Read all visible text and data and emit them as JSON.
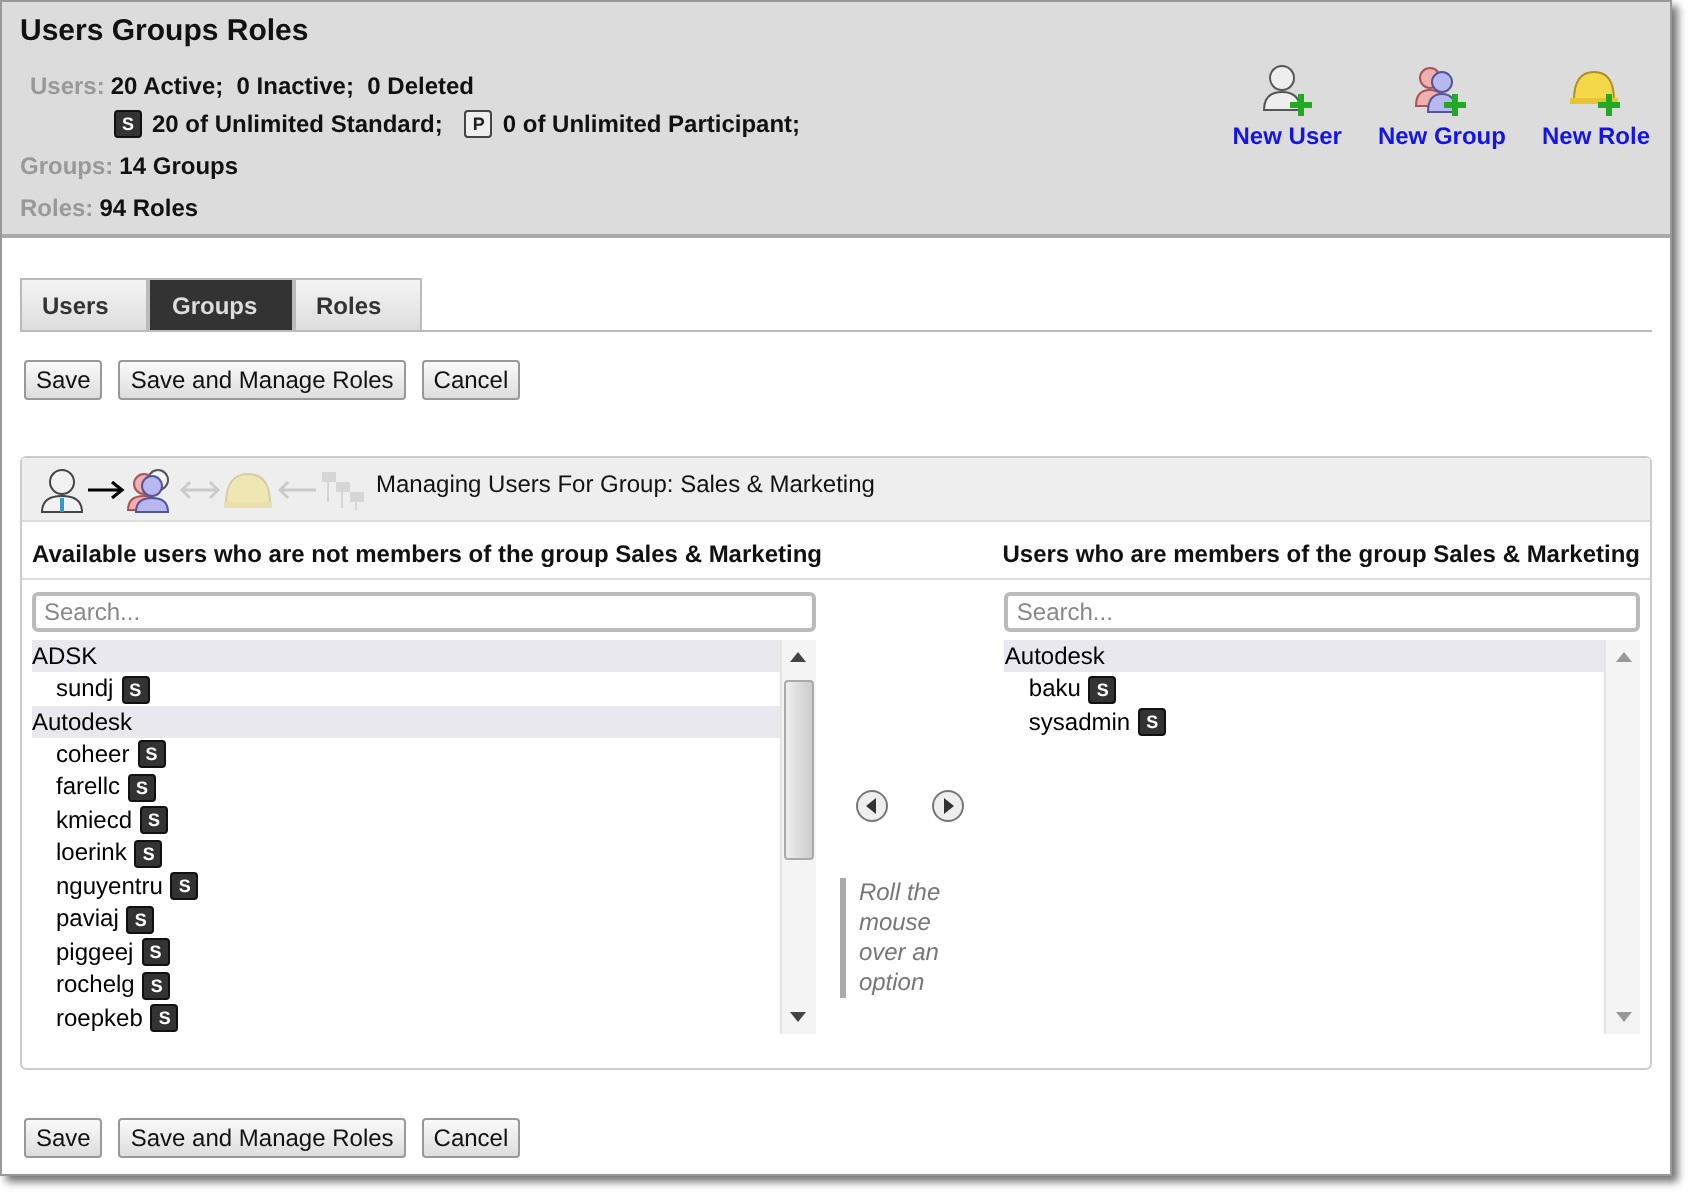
{
  "header": {
    "title": "Users Groups Roles",
    "users": {
      "label": "Users:",
      "value": "20 Active;  0 Inactive;  0 Deleted"
    },
    "licenses": [
      {
        "badge": "S",
        "kind": "dark",
        "text": "20 of Unlimited Standard;"
      },
      {
        "badge": "P",
        "kind": "light",
        "text": "0 of Unlimited Participant;"
      }
    ],
    "groups": {
      "label": "Groups:",
      "value": "14 Groups"
    },
    "roles": {
      "label": "Roles:",
      "value": "94 Roles"
    },
    "actions": [
      {
        "kind": "user",
        "label": "New User"
      },
      {
        "kind": "group",
        "label": "New Group"
      },
      {
        "kind": "role",
        "label": "New Role"
      }
    ]
  },
  "tabs": [
    {
      "label": "Users",
      "selected": false
    },
    {
      "label": "Groups",
      "selected": true
    },
    {
      "label": "Roles",
      "selected": false
    }
  ],
  "buttons_top": [
    "Save",
    "Save and Manage Roles",
    "Cancel"
  ],
  "manager": {
    "title": "Managing Users For Group: Sales & Marketing",
    "steps": [
      {
        "kind": "user",
        "active": true
      },
      {
        "kind": "arrow",
        "active": true
      },
      {
        "kind": "group",
        "active": true
      },
      {
        "kind": "both",
        "active": false
      },
      {
        "kind": "role",
        "active": false
      },
      {
        "kind": "back",
        "active": false
      },
      {
        "kind": "tree",
        "active": false
      }
    ],
    "available": {
      "heading": "Available users who are not members of the group Sales & Marketing",
      "placeholder": "Search...",
      "groups": [
        {
          "name": "ADSK",
          "users": [
            {
              "name": "sundj",
              "badge": "S"
            }
          ]
        },
        {
          "name": "Autodesk",
          "users": [
            {
              "name": "coheer",
              "badge": "S"
            },
            {
              "name": "farellc",
              "badge": "S"
            },
            {
              "name": "kmiecd",
              "badge": "S"
            },
            {
              "name": "loerink",
              "badge": "S"
            },
            {
              "name": "nguyentru",
              "badge": "S"
            },
            {
              "name": "paviaj",
              "badge": "S"
            },
            {
              "name": "piggeej",
              "badge": "S"
            },
            {
              "name": "rochelg",
              "badge": "S"
            },
            {
              "name": "roepkeb",
              "badge": "S"
            }
          ]
        }
      ]
    },
    "hint": "Roll the mouse over an option",
    "members": {
      "heading": "Users who are members of the group Sales & Marketing",
      "placeholder": "Search...",
      "groups": [
        {
          "name": "Autodesk",
          "users": [
            {
              "name": "baku",
              "badge": "S"
            },
            {
              "name": "sysadmin",
              "badge": "S"
            }
          ]
        }
      ]
    }
  },
  "buttons_bottom": [
    "Save",
    "Save and Manage Roles",
    "Cancel"
  ]
}
